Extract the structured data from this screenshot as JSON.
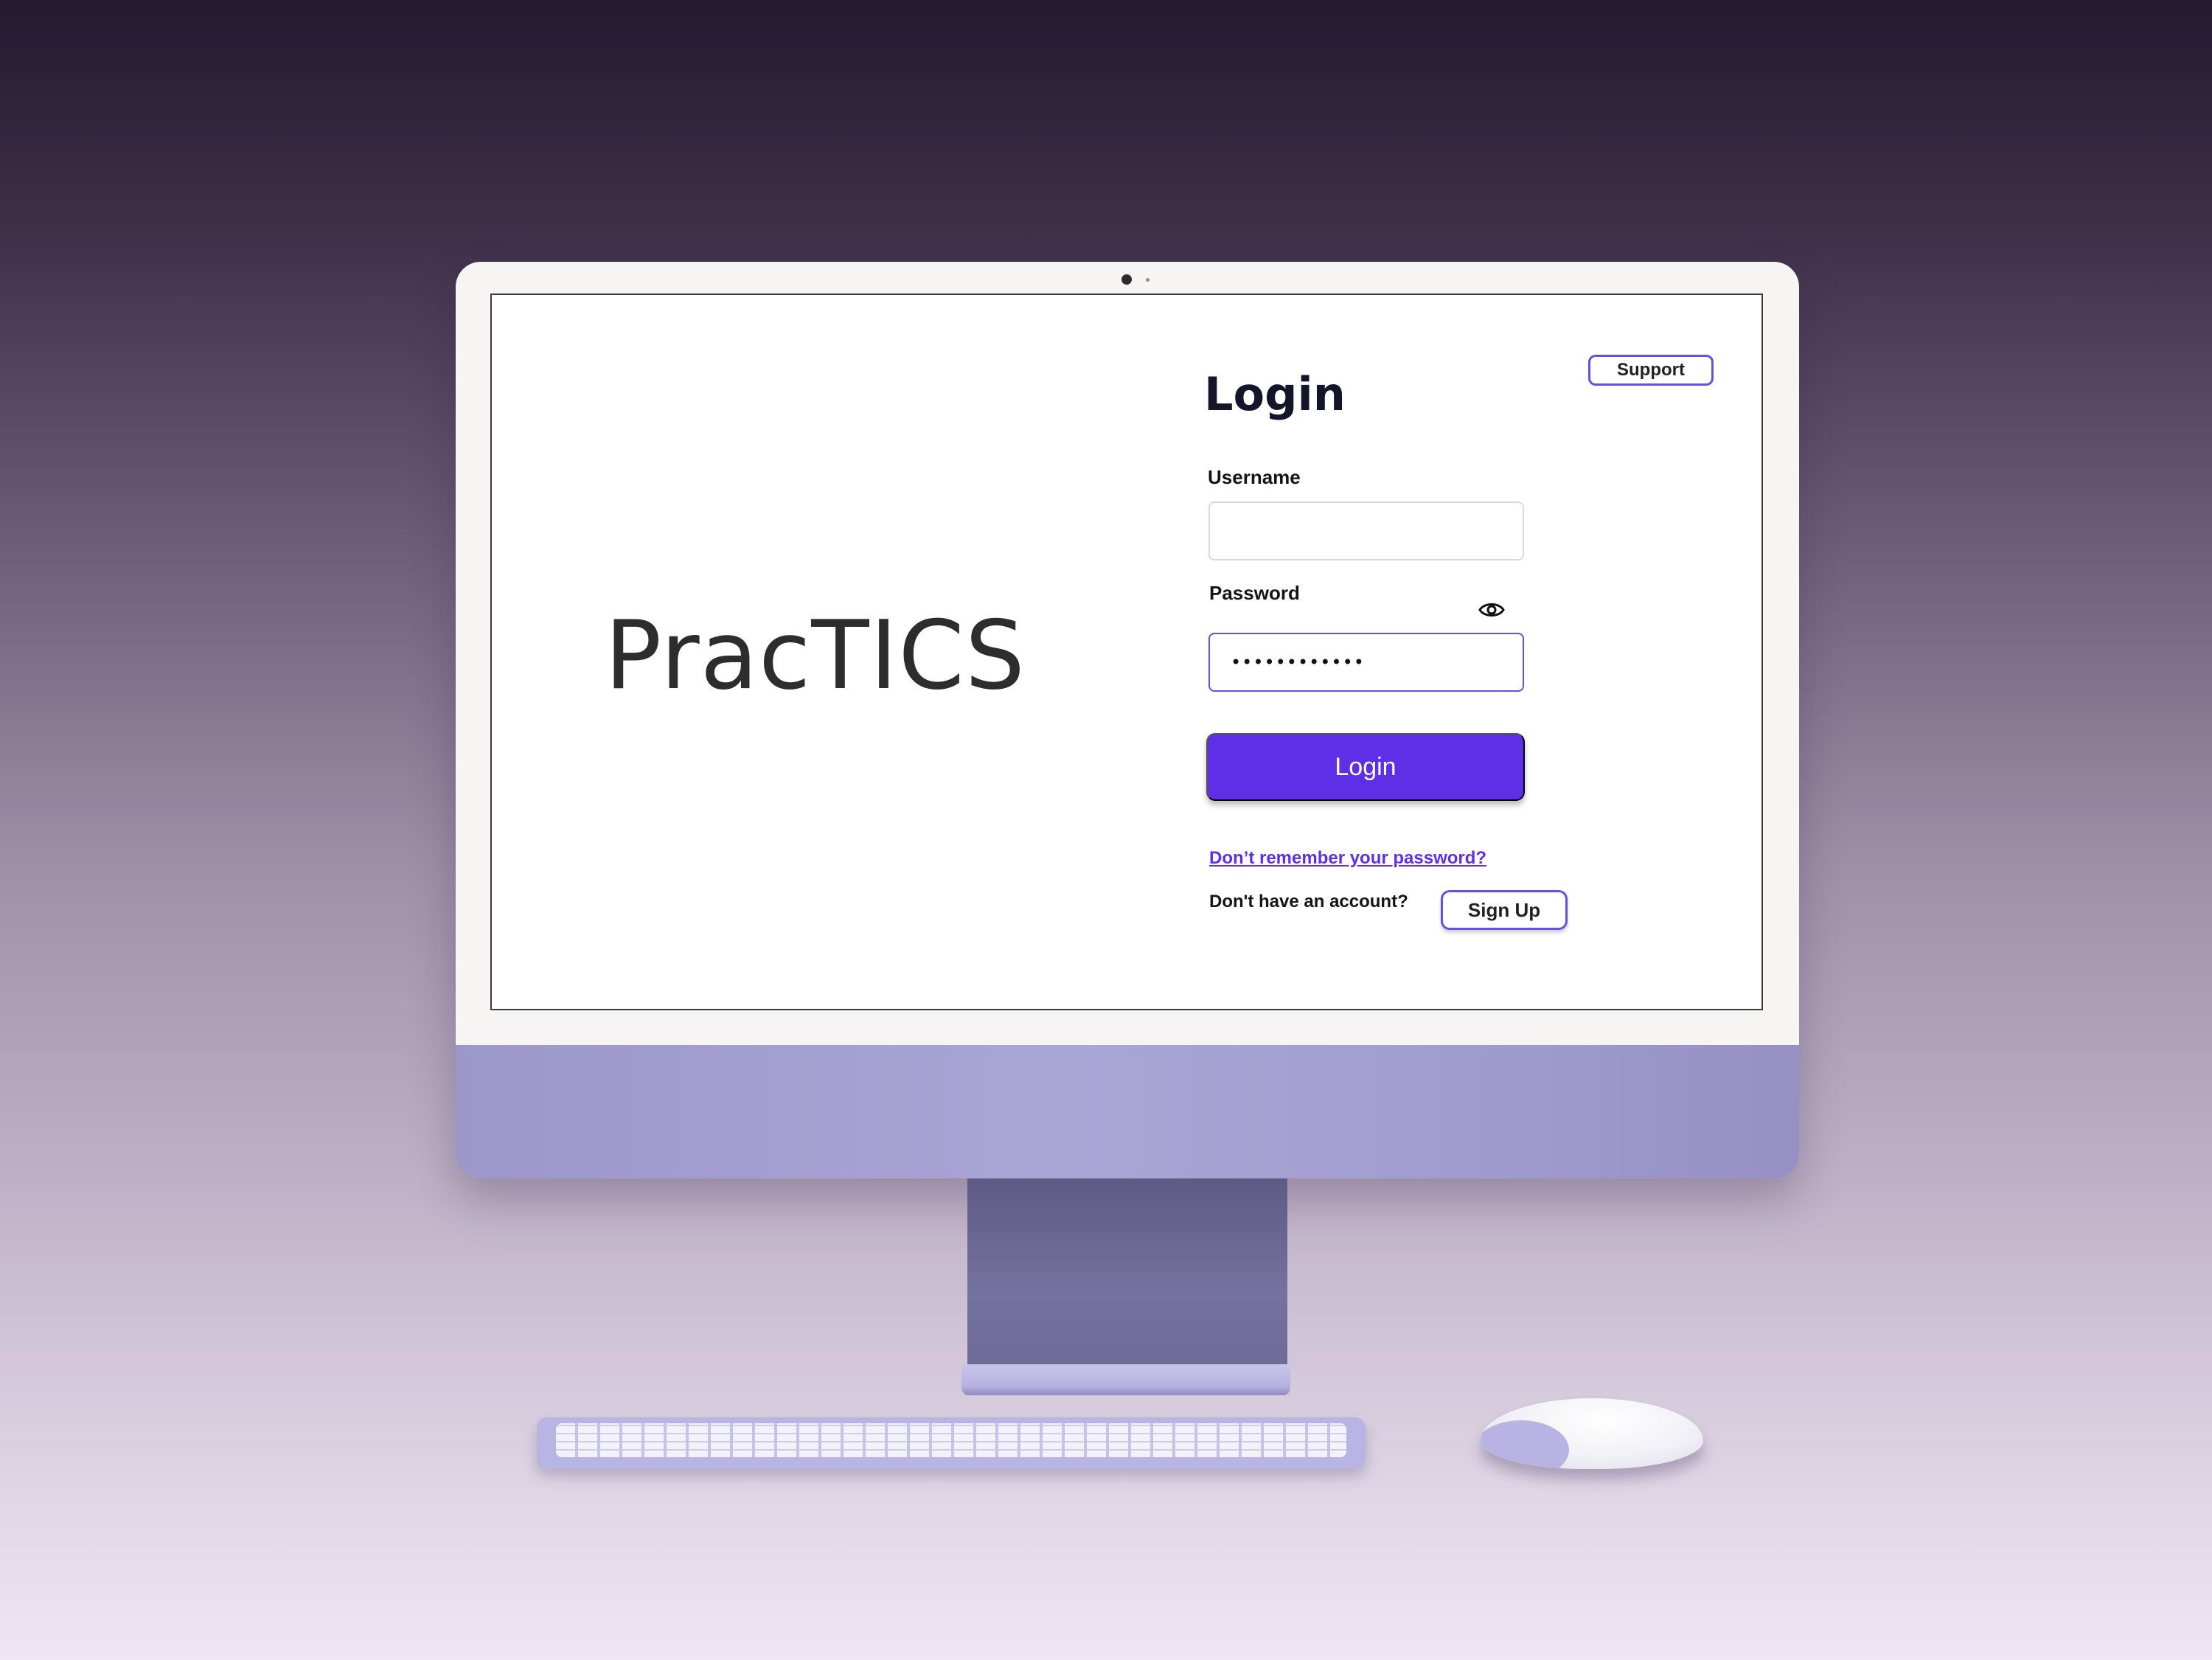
{
  "app": {
    "brand_name": "PracTICS"
  },
  "header": {
    "support_label": "Support"
  },
  "login_form": {
    "title": "Login",
    "username_label": "Username",
    "username_value": "",
    "password_label": "Password",
    "password_value": "••••••••••••",
    "show_password_icon": "eye-icon",
    "submit_label": "Login",
    "forgot_password_link": "Don’t remember your password?",
    "no_account_text": "Don't have an account?",
    "signup_label": "Sign Up"
  },
  "colors": {
    "accent": "#5f2fe8",
    "outline": "#6a4ee0",
    "device_purple": "#a9a6d6"
  }
}
